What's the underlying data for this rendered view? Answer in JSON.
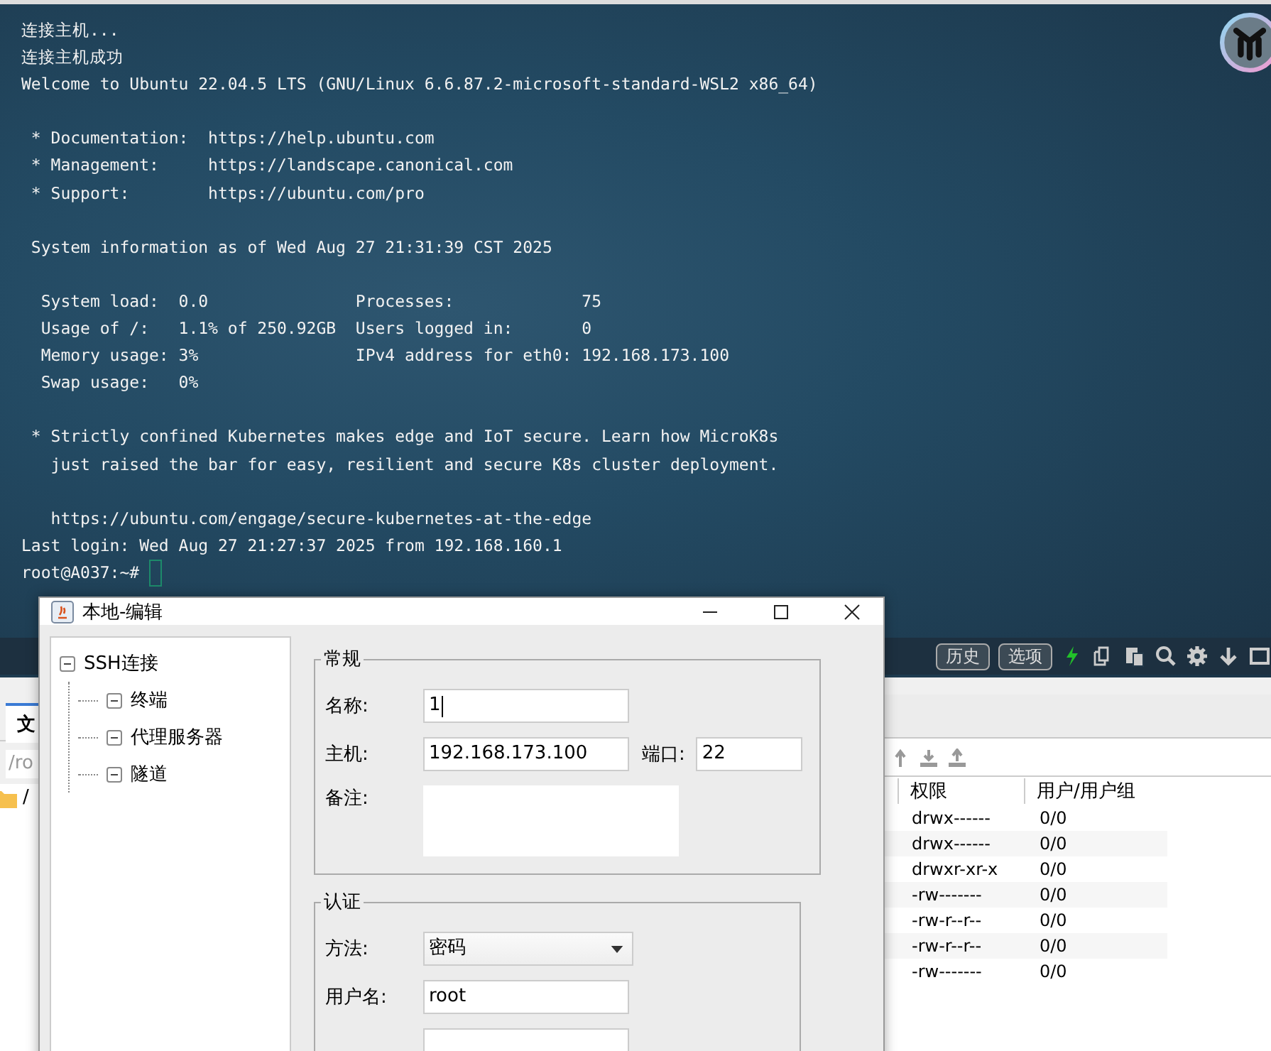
{
  "terminal": {
    "lines": [
      {
        "kind": "text",
        "text": "连接主机..."
      },
      {
        "kind": "text",
        "text": "连接主机成功"
      },
      {
        "kind": "text",
        "text": "Welcome to Ubuntu 22.04.5 LTS (GNU/Linux 6.6.87.2-microsoft-standard-WSL2 x86_64)"
      },
      {
        "kind": "blank"
      },
      {
        "kind": "text",
        "text": " * Documentation:  https://help.ubuntu.com"
      },
      {
        "kind": "text",
        "text": " * Management:     https://landscape.canonical.com"
      },
      {
        "kind": "text",
        "text": " * Support:        https://ubuntu.com/pro"
      },
      {
        "kind": "blank"
      },
      {
        "kind": "text",
        "text": " System information as of Wed Aug 27 21:31:39 CST 2025"
      },
      {
        "kind": "blank"
      },
      {
        "kind": "text",
        "text": "  System load:  0.0               Processes:             75"
      },
      {
        "kind": "text",
        "text": "  Usage of /:   1.1% of 250.92GB  Users logged in:       0"
      },
      {
        "kind": "text",
        "text": "  Memory usage: 3%                IPv4 address for eth0: 192.168.173.100"
      },
      {
        "kind": "text",
        "text": "  Swap usage:   0%"
      },
      {
        "kind": "blank"
      },
      {
        "kind": "text",
        "text": " * Strictly confined Kubernetes makes edge and IoT secure. Learn how MicroK8s"
      },
      {
        "kind": "text",
        "text": "   just raised the bar for easy, resilient and secure K8s cluster deployment."
      },
      {
        "kind": "blank"
      },
      {
        "kind": "text",
        "text": "   https://ubuntu.com/engage/secure-kubernetes-at-the-edge"
      },
      {
        "kind": "text",
        "text": "Last login: Wed Aug 27 21:27:37 2025 from 192.168.160.1"
      },
      {
        "kind": "prompt",
        "text": "root@A037:~#"
      }
    ],
    "toolbar": {
      "buttons": [
        "历史",
        "选项"
      ]
    }
  },
  "file_panel": {
    "tab": "文",
    "path": "/ro",
    "root": "/",
    "columns": [
      "权限",
      "用户/用户组"
    ],
    "rows": [
      {
        "permissions": "drwx------",
        "owner": "0/0"
      },
      {
        "permissions": "drwx------",
        "owner": "0/0"
      },
      {
        "permissions": "drwxr-xr-x",
        "owner": "0/0"
      },
      {
        "permissions": "-rw-------",
        "owner": "0/0"
      },
      {
        "permissions": "-rw-r--r--",
        "owner": "0/0"
      },
      {
        "permissions": "-rw-r--r--",
        "owner": "0/0"
      },
      {
        "permissions": "-rw-------",
        "owner": "0/0"
      }
    ]
  },
  "dialog": {
    "title": "本地-编辑",
    "tree": [
      {
        "label": "SSH连接",
        "expanded": true,
        "children": [
          {
            "label": "终端",
            "expanded": true
          },
          {
            "label": "代理服务器",
            "expanded": true
          },
          {
            "label": "隧道",
            "expanded": true
          }
        ]
      }
    ],
    "general": {
      "legend": "常规",
      "name_label": "名称:",
      "name": "1",
      "host_label": "主机:",
      "host": "192.168.173.100",
      "port_label": "端口:",
      "port": "22",
      "remark_label": "备注:"
    },
    "auth": {
      "legend": "认证",
      "method_label": "方法:",
      "method": "密码",
      "user_label": "用户名:",
      "user": "root"
    }
  }
}
